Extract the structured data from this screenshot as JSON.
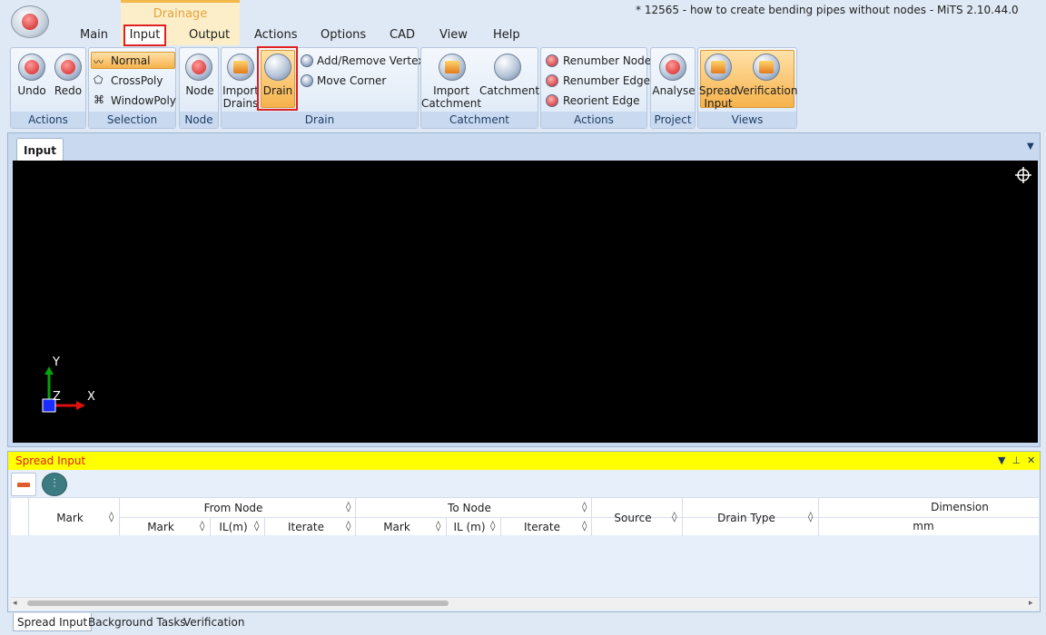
{
  "window": {
    "title": "* 12565 - how to create bending pipes without nodes - MiTS 2.10.44.0",
    "logo_icon": "mits-logo-icon"
  },
  "context_tab": {
    "label": "Drainage"
  },
  "menu_tabs": [
    "Main",
    "Input",
    "Output",
    "Actions",
    "Options",
    "CAD",
    "View",
    "Help"
  ],
  "ribbon": {
    "groups": {
      "actions1": "Actions",
      "selection": "Selection",
      "node": "Node",
      "drain": "Drain",
      "catchment": "Catchment",
      "actions2": "Actions",
      "project": "Project",
      "views": "Views"
    },
    "undo": "Undo",
    "redo": "Redo",
    "normal": "Normal",
    "crosspoly": "CrossPoly",
    "windowpoly": "WindowPoly",
    "node": "Node",
    "import_drains_1": "Import",
    "import_drains_2": "Drains",
    "drain": "Drain",
    "add_remove_vertex": "Add/Remove Vertex",
    "move_corner": "Move Corner",
    "import_catchment_1": "Import",
    "import_catchment_2": "Catchment",
    "catchment": "Catchment",
    "renumber_node": "Renumber Node",
    "renumber_edge": "Renumber Edge",
    "reorient_edge": "Reorient Edge",
    "analyse": "Analyse",
    "spread_input_1": "Spread",
    "spread_input_2": "Input",
    "verification": "Verification"
  },
  "doc": {
    "tab": "Input",
    "axis_x": "X",
    "axis_y": "Y",
    "axis_z": "Z"
  },
  "spread": {
    "title": "Spread Input",
    "headers": {
      "mark": "Mark",
      "from_node": "From Node",
      "to_node": "To Node",
      "from_mark": "Mark",
      "from_il": "IL(m)",
      "from_iterate": "Iterate",
      "to_mark": "Mark",
      "to_il": "IL (m)",
      "to_iterate": "Iterate",
      "source": "Source",
      "drain_type": "Drain Type",
      "dimension": "Dimension",
      "dimension_unit": "mm"
    }
  },
  "bottom_tabs": [
    "Spread Input",
    "Background Tasks",
    "Verification"
  ]
}
